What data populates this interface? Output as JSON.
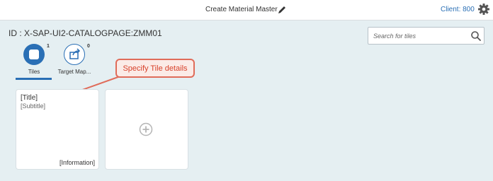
{
  "shell": {
    "title": "Create Material Master",
    "client": "Client: 800"
  },
  "page": {
    "id_label": "ID : X-SAP-UI2-CATALOGPAGE:ZMM01"
  },
  "search": {
    "placeholder": "Search for tiles"
  },
  "tabs": [
    {
      "label": "Tiles",
      "count": "1",
      "icon": "tile-icon",
      "selected": true
    },
    {
      "label": "Target Map...",
      "count": "0",
      "icon": "share-icon",
      "selected": false
    }
  ],
  "callout": {
    "text": "Specify Tile details"
  },
  "tiles": [
    {
      "title": "[Title]",
      "subtitle": "[Subtitle]",
      "info": "[Information]"
    }
  ],
  "add_tile": {
    "icon": "add-icon"
  },
  "colors": {
    "accent": "#2a6fb5",
    "background": "#e5eff2",
    "callout_border": "#e06c5a",
    "callout_text": "#d8412a"
  }
}
